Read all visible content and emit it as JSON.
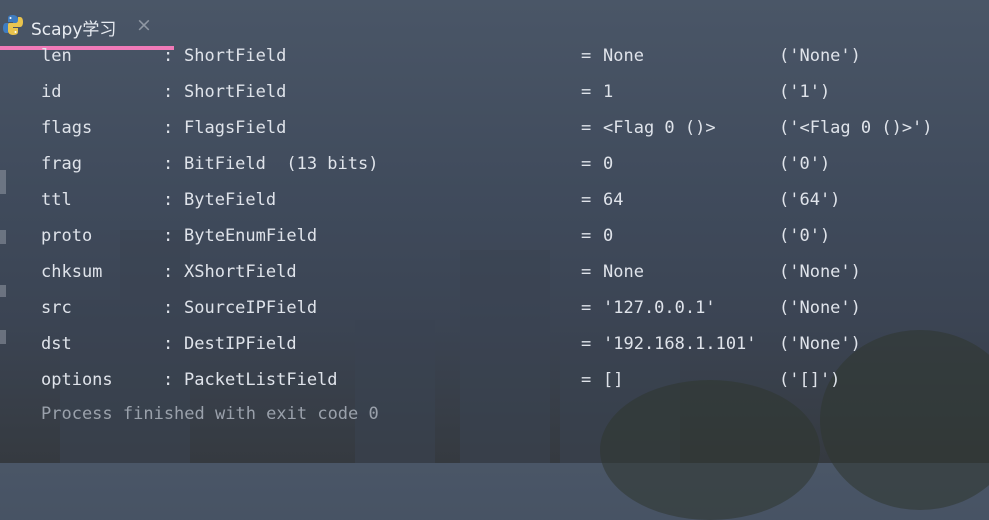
{
  "tab": {
    "title": "Scapy学习",
    "close_glyph": "×",
    "icon": "python-icon",
    "accent": "#f07ab8"
  },
  "rows": [
    {
      "name": "len",
      "colon": ":",
      "type": "ShortField",
      "eq": "=",
      "value": "None",
      "default": "('None')"
    },
    {
      "name": "id",
      "colon": ":",
      "type": "ShortField",
      "eq": "=",
      "value": "1",
      "default": "('1')"
    },
    {
      "name": "flags",
      "colon": ":",
      "type": "FlagsField",
      "eq": "=",
      "value": "<Flag 0 ()>",
      "default": "('<Flag 0 ()>')"
    },
    {
      "name": "frag",
      "colon": ":",
      "type": "BitField  (13 bits)",
      "eq": "=",
      "value": "0",
      "default": "('0')"
    },
    {
      "name": "ttl",
      "colon": ":",
      "type": "ByteField",
      "eq": "=",
      "value": "64",
      "default": "('64')"
    },
    {
      "name": "proto",
      "colon": ":",
      "type": "ByteEnumField",
      "eq": "=",
      "value": "0",
      "default": "('0')"
    },
    {
      "name": "chksum",
      "colon": ":",
      "type": "XShortField",
      "eq": "=",
      "value": "None",
      "default": "('None')"
    },
    {
      "name": "src",
      "colon": ":",
      "type": "SourceIPField",
      "eq": "=",
      "value": "'127.0.0.1'",
      "default": "('None')"
    },
    {
      "name": "dst",
      "colon": ":",
      "type": "DestIPField",
      "eq": "=",
      "value": "'192.168.1.101'",
      "default": "('None')"
    },
    {
      "name": "options",
      "colon": ":",
      "type": "PacketListField",
      "eq": "=",
      "value": "[]",
      "default": "('[]')"
    }
  ],
  "exit_message": "Process finished with exit code 0"
}
